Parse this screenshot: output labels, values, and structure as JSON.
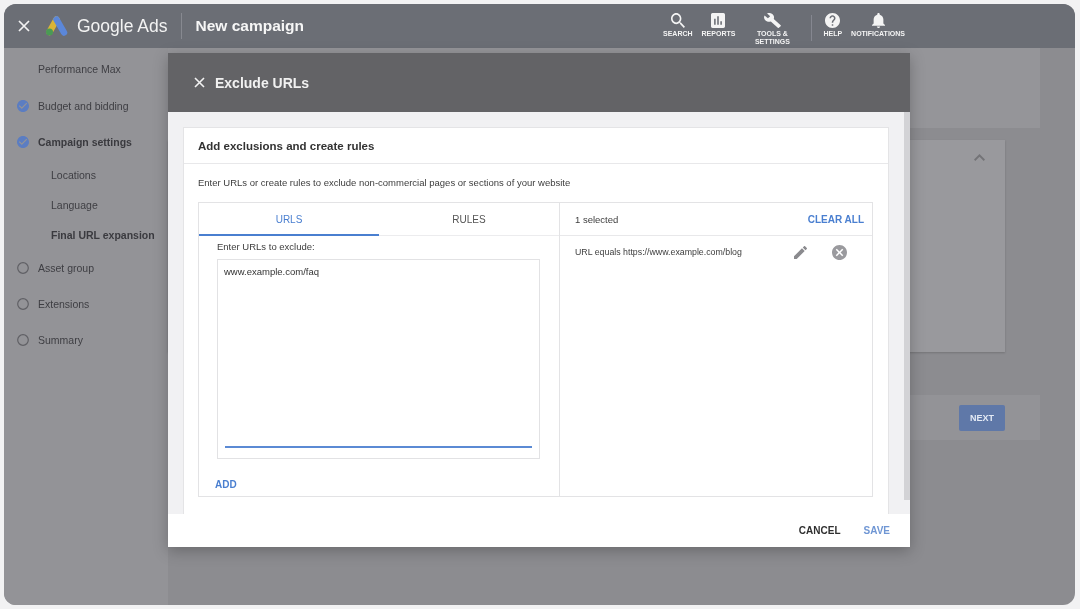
{
  "header": {
    "app_name": "Google Ads",
    "page_title": "New campaign",
    "toolbar_groups": [
      {
        "items": [
          {
            "kind": "search",
            "label": "SEARCH"
          },
          {
            "kind": "reports",
            "label": "REPORTS"
          },
          {
            "kind": "tools",
            "label": "TOOLS & SETTINGS"
          }
        ]
      },
      {
        "items": [
          {
            "kind": "help",
            "label": "HELP"
          },
          {
            "kind": "notifications",
            "label": "NOTIFICATIONS"
          }
        ]
      }
    ]
  },
  "sidebar": {
    "campaign_type": "Performance Max",
    "steps": [
      {
        "label": "Budget and bidding",
        "completed": true,
        "selected": false
      },
      {
        "label": "Campaign settings",
        "completed": true,
        "selected": true,
        "children": [
          {
            "label": "Locations",
            "selected": false
          },
          {
            "label": "Language",
            "selected": false
          },
          {
            "label": "Final URL expansion",
            "selected": true
          }
        ]
      },
      {
        "label": "Asset group",
        "completed": false,
        "selected": false
      },
      {
        "label": "Extensions",
        "completed": false,
        "selected": false
      },
      {
        "label": "Summary",
        "completed": false,
        "selected": false
      }
    ]
  },
  "page": {
    "section": {
      "expanded": true
    },
    "next_button": {
      "label": "NEXT"
    }
  },
  "modal": {
    "title": "Exclude URLs",
    "card_title": "Add exclusions and create rules",
    "description": "Enter URLs or create rules to exclude non-commercial pages or sections of your website",
    "tabs": [
      {
        "label": "URLS",
        "selected": true
      },
      {
        "label": "RULES",
        "selected": false
      }
    ],
    "url_field": {
      "label": "Enter URLs to exclude:",
      "value": "www.example.com/faq",
      "focused": true
    },
    "add_link": "ADD",
    "selected_count": "1 selected",
    "clear_all": "CLEAR ALL",
    "exclusions": [
      {
        "text": "URL equals https://www.example.com/blog"
      }
    ],
    "actions": [
      {
        "kind": "secondary",
        "label": "CANCEL"
      },
      {
        "kind": "primary",
        "label": "SAVE"
      }
    ]
  }
}
